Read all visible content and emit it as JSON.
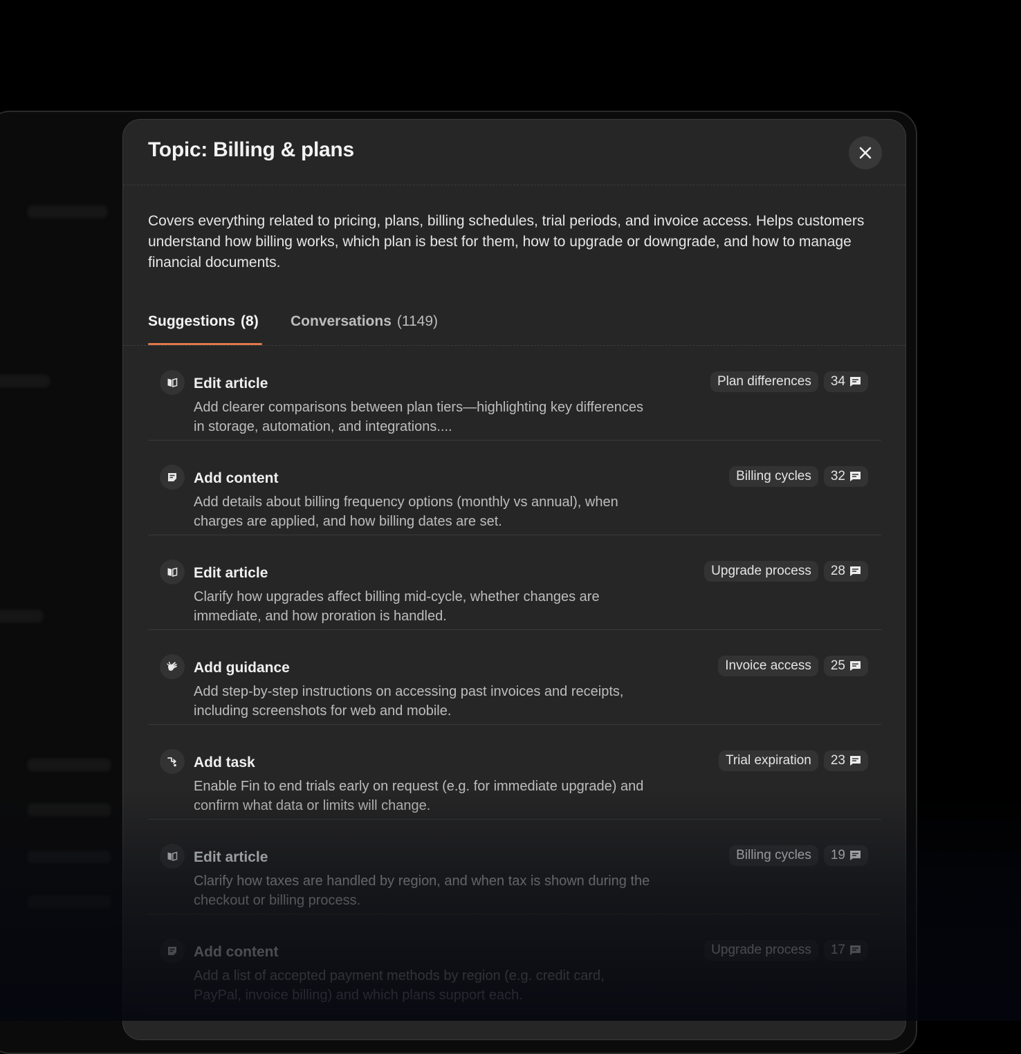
{
  "dialog": {
    "title": "Topic: Billing & plans",
    "description": "Covers everything related to pricing, plans, billing schedules, trial periods, and invoice access. Helps customers understand how billing works, which plan is best for them, how to upgrade or downgrade, and how to manage financial documents."
  },
  "tabs": [
    {
      "label": "Suggestions",
      "count": "(8)",
      "active": true
    },
    {
      "label": "Conversations",
      "count": "(1149)",
      "active": false
    }
  ],
  "suggestions": [
    {
      "icon": "book-icon",
      "title": "Edit article",
      "description": "Add clearer comparisons between plan tiers—highlighting key differences in storage, automation, and integrations....",
      "tag": "Plan differences",
      "count": "34"
    },
    {
      "icon": "note-icon",
      "title": "Add content",
      "description": "Add details about billing frequency options (monthly vs annual), when charges are applied, and how billing dates are set.",
      "tag": "Billing cycles",
      "count": "32"
    },
    {
      "icon": "book-icon",
      "title": "Edit article",
      "description": "Clarify how upgrades affect billing mid-cycle, whether changes are immediate, and how proration is handled.",
      "tag": "Upgrade process",
      "count": "28"
    },
    {
      "icon": "hand-icon",
      "title": "Add guidance",
      "description": "Add step-by-step instructions on accessing past invoices and receipts, including screenshots for web and mobile.",
      "tag": "Invoice access",
      "count": "25"
    },
    {
      "icon": "task-icon",
      "title": "Add task",
      "description": "Enable Fin to end trials early on request (e.g. for immediate upgrade) and confirm what data or limits will change.",
      "tag": "Trial expiration",
      "count": "23"
    },
    {
      "icon": "book-icon",
      "title": "Edit article",
      "description": "Clarify how taxes are handled by region, and when tax is shown during the checkout or billing process.",
      "tag": "Billing cycles",
      "count": "19"
    },
    {
      "icon": "note-icon",
      "title": "Add content",
      "description": "Add a list of accepted payment methods by region (e.g. credit card, PayPal, invoice billing) and which plans support each.",
      "tag": "Upgrade process",
      "count": "17"
    }
  ]
}
